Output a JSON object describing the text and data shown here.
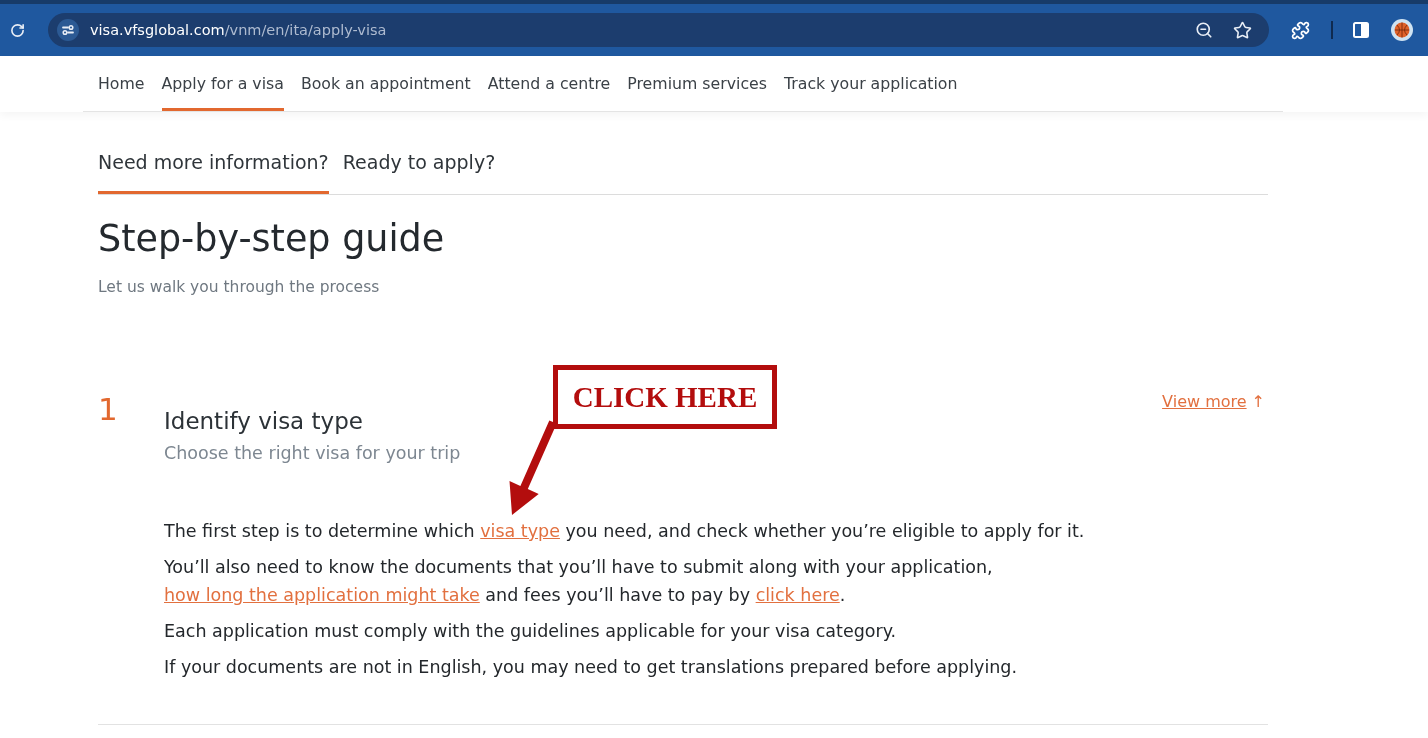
{
  "browser": {
    "url_host": "visa.vfsglobal.com",
    "url_path": "/vnm/en/ita/apply-visa"
  },
  "nav": {
    "items": [
      {
        "label": "Home",
        "selected": false
      },
      {
        "label": "Apply for a visa",
        "selected": true
      },
      {
        "label": "Book an appointment",
        "selected": false
      },
      {
        "label": "Attend a centre",
        "selected": false
      },
      {
        "label": "Premium services",
        "selected": false
      },
      {
        "label": "Track your application",
        "selected": false
      }
    ]
  },
  "section_tabs": [
    {
      "label": "Need more information?",
      "selected": true
    },
    {
      "label": "Ready to apply?",
      "selected": false
    }
  ],
  "guide": {
    "title": "Step-by-step guide",
    "subtitle": "Let us walk you through the process"
  },
  "steps": [
    {
      "number": "1",
      "title": "Identify visa type",
      "subtitle": "Choose the right visa for your trip",
      "view_more": "View more",
      "view_more_arrow": "↑",
      "paragraphs": [
        {
          "segments": [
            {
              "kind": "text",
              "text": "The first step is to determine which "
            },
            {
              "kind": "link",
              "text": "visa type"
            },
            {
              "kind": "text",
              "text": " you need, and check whether you’re eligible to apply for it."
            }
          ]
        },
        {
          "segments": [
            {
              "kind": "text",
              "text": "You’ll also need to know the documents that you’ll have to submit along with your application, "
            },
            {
              "kind": "link",
              "text": "how long the application might take"
            },
            {
              "kind": "text",
              "text": " and fees you’ll have to pay by "
            },
            {
              "kind": "link",
              "text": "click here"
            },
            {
              "kind": "text",
              "text": "."
            }
          ]
        },
        {
          "segments": [
            {
              "kind": "text",
              "text": "Each application must comply with the guidelines applicable for your visa category."
            }
          ]
        },
        {
          "segments": [
            {
              "kind": "text",
              "text": "If your documents are not in English, you may need to get translations prepared before applying."
            }
          ]
        }
      ]
    }
  ],
  "annotation": {
    "label": "CLICK HERE"
  }
}
